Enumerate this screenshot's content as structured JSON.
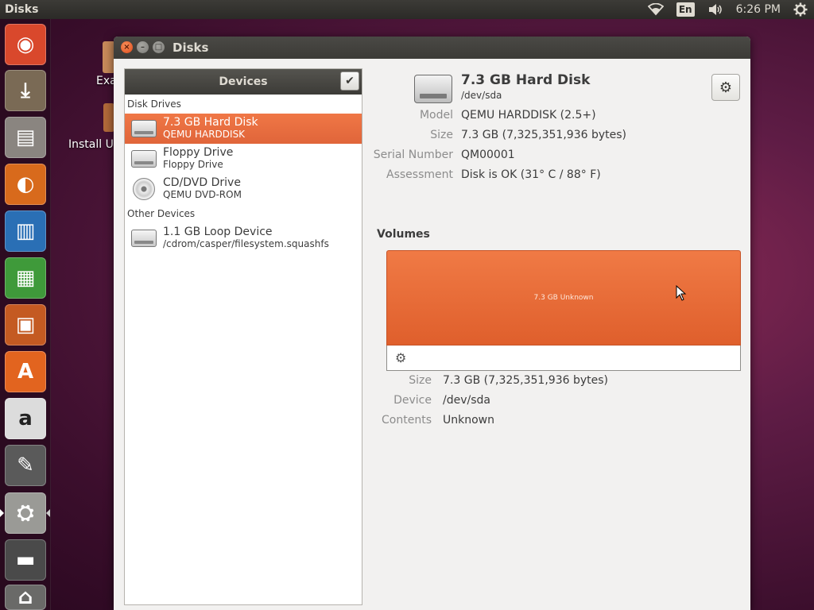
{
  "top_panel": {
    "app_title": "Disks",
    "lang": "En",
    "time": "6:26 PM"
  },
  "launcher": {
    "items": [
      {
        "name": "ubuntu-dash-icon",
        "glyph": "◉",
        "bg": "#d9482c"
      },
      {
        "name": "install-ubuntu-icon",
        "glyph": "⤓",
        "bg": "#7a6a55"
      },
      {
        "name": "files-icon",
        "glyph": "▤",
        "bg": "#8a8580"
      },
      {
        "name": "firefox-icon",
        "glyph": "◐",
        "bg": "#d86a1c"
      },
      {
        "name": "libreoffice-writer-icon",
        "glyph": "▥",
        "bg": "#2a6fb5"
      },
      {
        "name": "libreoffice-calc-icon",
        "glyph": "▦",
        "bg": "#3f9a3a"
      },
      {
        "name": "libreoffice-impress-icon",
        "glyph": "▣",
        "bg": "#c45a22"
      },
      {
        "name": "ubuntu-software-icon",
        "glyph": "A",
        "bg": "#e2641f"
      },
      {
        "name": "amazon-icon",
        "glyph": "a",
        "bg": "#dcdcdc"
      },
      {
        "name": "system-settings-icon",
        "glyph": "✎",
        "bg": "#5a5a5a"
      },
      {
        "name": "disks-icon",
        "glyph": "⛭",
        "bg": "#9a9a96"
      },
      {
        "name": "floppy-icon",
        "glyph": "▬",
        "bg": "#4a4a4a"
      },
      {
        "name": "trash-icon",
        "glyph": "⌂",
        "bg": "#6a6a68"
      }
    ]
  },
  "desktop": {
    "examples_label": "Exa",
    "install_label": "Install Ub"
  },
  "window": {
    "title": "Disks"
  },
  "sidebar": {
    "header": "Devices",
    "select_icon": "✔",
    "groups": {
      "disk_drives": "Disk Drives",
      "other_devices": "Other Devices"
    },
    "drives": [
      {
        "title": "7.3 GB Hard Disk",
        "subtitle": "QEMU HARDDISK"
      },
      {
        "title": "Floppy Drive",
        "subtitle": "Floppy Drive"
      },
      {
        "title": "CD/DVD Drive",
        "subtitle": "QEMU DVD-ROM"
      }
    ],
    "other": [
      {
        "title": "1.1 GB Loop Device",
        "subtitle": "/cdrom/casper/filesystem.squashfs"
      }
    ]
  },
  "details": {
    "disk_title": "7.3 GB Hard Disk",
    "disk_path": "/dev/sda",
    "gear_icon": "⚙",
    "props": [
      {
        "k": "Model",
        "v": "QEMU HARDDISK (2.5+)"
      },
      {
        "k": "Size",
        "v": "7.3 GB (7,325,351,936 bytes)"
      },
      {
        "k": "Serial Number",
        "v": "QM00001"
      },
      {
        "k": "Assessment",
        "v": "Disk is OK (31° C / 88° F)"
      }
    ],
    "volumes_label": "Volumes",
    "volume_bar_label": "7.3 GB Unknown",
    "volume_tool_icon": "⚙",
    "volume_props": [
      {
        "k": "Size",
        "v": "7.3 GB (7,325,351,936 bytes)"
      },
      {
        "k": "Device",
        "v": "/dev/sda"
      },
      {
        "k": "Contents",
        "v": "Unknown"
      }
    ]
  },
  "colors": {
    "accent": "#e95420",
    "panel_dark": "#3c3b37"
  }
}
